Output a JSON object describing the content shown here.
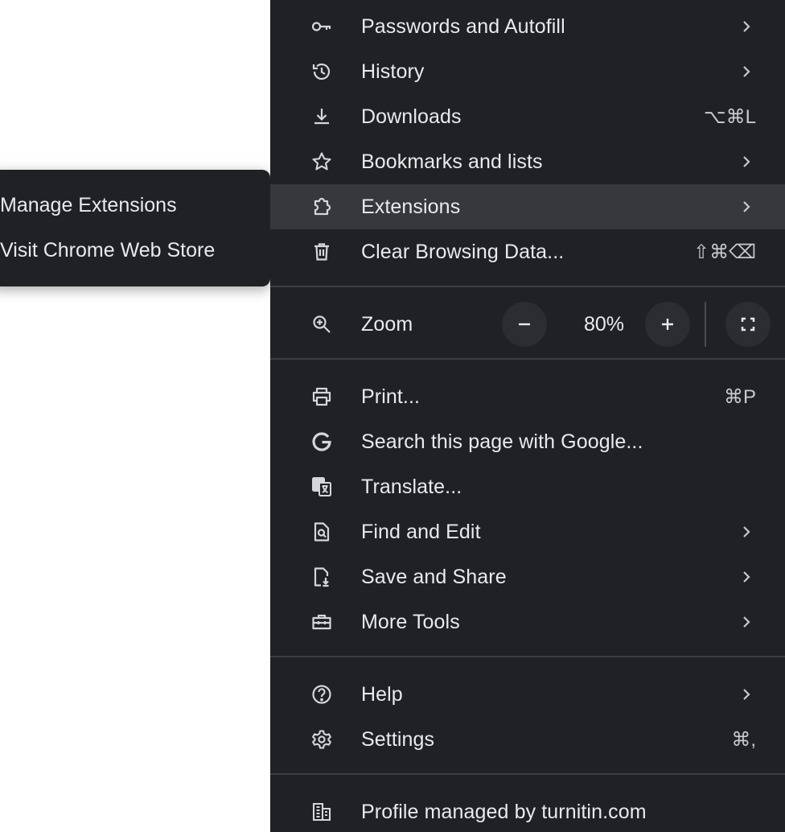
{
  "submenu": {
    "items": [
      {
        "label": "Manage Extensions"
      },
      {
        "label": "Visit Chrome Web Store"
      }
    ]
  },
  "menu": {
    "items": {
      "passwords": {
        "label": "Passwords and Autofill",
        "icon": "key-icon"
      },
      "history": {
        "label": "History",
        "icon": "history-icon"
      },
      "downloads": {
        "label": "Downloads",
        "icon": "download-icon",
        "shortcut": "⌥⌘L"
      },
      "bookmarks": {
        "label": "Bookmarks and lists",
        "icon": "star-icon"
      },
      "extensions": {
        "label": "Extensions",
        "icon": "puzzle-icon"
      },
      "clear": {
        "label": "Clear Browsing Data...",
        "icon": "trash-icon",
        "shortcut": "⇧⌘⌫"
      },
      "print": {
        "label": "Print...",
        "icon": "printer-icon",
        "shortcut": "⌘P"
      },
      "search_google": {
        "label": "Search this page with Google...",
        "icon": "google-icon"
      },
      "translate": {
        "label": "Translate...",
        "icon": "translate-icon"
      },
      "find_edit": {
        "label": "Find and Edit",
        "icon": "find-document-icon"
      },
      "save_share": {
        "label": "Save and Share",
        "icon": "save-document-icon"
      },
      "more_tools": {
        "label": "More Tools",
        "icon": "toolbox-icon"
      },
      "help": {
        "label": "Help",
        "icon": "help-icon"
      },
      "settings": {
        "label": "Settings",
        "icon": "gear-icon",
        "shortcut": "⌘,"
      },
      "profile": {
        "label": "Profile managed by turnitin.com",
        "icon": "building-icon"
      }
    },
    "zoom": {
      "label": "Zoom",
      "value": "80%",
      "icon": "zoom-icon"
    }
  },
  "colors": {
    "menu_bg": "#202124",
    "highlight": "#37383b",
    "text": "#e8eaed"
  }
}
